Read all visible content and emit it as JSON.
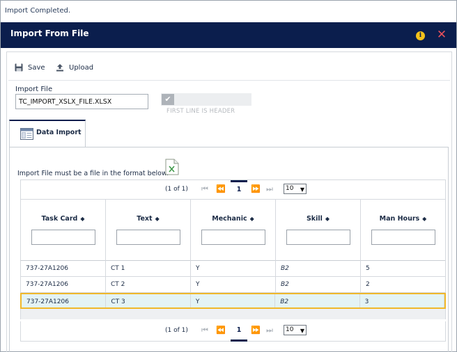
{
  "status": {
    "message": "Import Completed."
  },
  "dialog": {
    "title": "Import From File"
  },
  "toolbar": {
    "save_label": "Save",
    "upload_label": "Upload"
  },
  "import_file": {
    "label": "Import File",
    "value": "TC_IMPORT_XSLX_FILE.XLSX"
  },
  "first_line_header": {
    "label": "FIRST LINE IS HEADER",
    "checked": true
  },
  "tab": {
    "label": "Data Import"
  },
  "note": "Import File must be a file in the format below.",
  "pager": {
    "count": "(1 of 1)",
    "page": "1",
    "rows_per_page": "10"
  },
  "grid": {
    "columns": [
      "Task Card",
      "Text",
      "Mechanic",
      "Skill",
      "Man Hours"
    ],
    "rows": [
      [
        "737-27A1206",
        "CT 1",
        "Y",
        "B2",
        "5"
      ],
      [
        "737-27A1206",
        "CT 2",
        "Y",
        "B2",
        "2"
      ],
      [
        "737-27A1206",
        "CT 3",
        "Y",
        "B2",
        "3"
      ]
    ],
    "selected_row": 2
  },
  "colors": {
    "title_bar": "#0b1e4d",
    "selection_border": "#f0b82a",
    "selection_fill": "#e4f3f5",
    "close": "#e8505b",
    "info": "#f4c21b"
  }
}
